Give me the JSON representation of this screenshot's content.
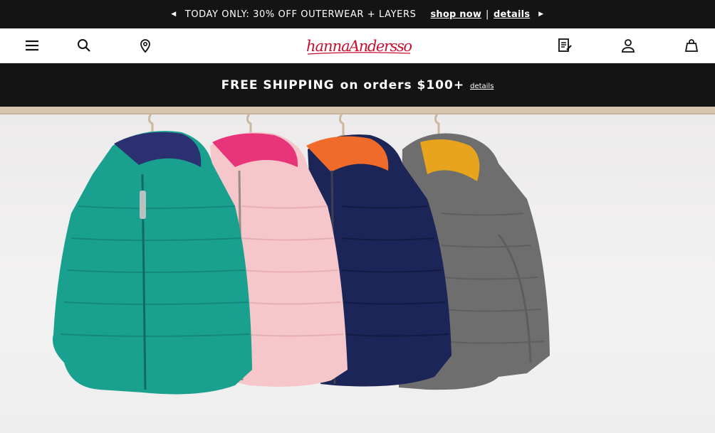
{
  "promo": {
    "message": "TODAY ONLY: 30% OFF OUTERWEAR + LAYERS",
    "shop_now": "shop now",
    "separator": "|",
    "details": "details"
  },
  "header": {
    "logo_text": "hannaAndersson",
    "icons": {
      "menu": "menu-icon",
      "search": "search-icon",
      "store": "location-pin-icon",
      "wishlist": "notepad-icon",
      "account": "user-icon",
      "bag": "shopping-bag-icon"
    }
  },
  "shipping": {
    "bold": "FREE SHIPPING",
    "text": "on orders $100+",
    "details": "details"
  },
  "hero": {
    "jackets": [
      {
        "color": "#1aa08e",
        "lining": "#2b3070"
      },
      {
        "color": "#f5c4c8",
        "lining": "#e8357a"
      },
      {
        "color": "#1b2557",
        "lining": "#f06a2a"
      },
      {
        "color": "#727272",
        "lining": "#e8a41c"
      }
    ],
    "colors": {
      "rail": "#d8c5b0",
      "background": "#eceaea"
    }
  }
}
